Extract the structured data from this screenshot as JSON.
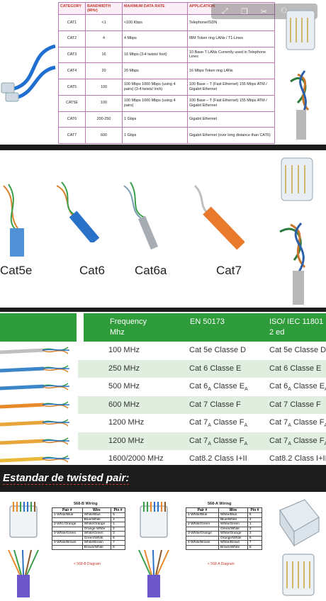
{
  "panel1": {
    "headers": [
      "CATEGORY",
      "BANDWIDTH (MHz)",
      "MAXIMUM DATA RATE",
      "APPLICATION"
    ],
    "rows": [
      {
        "category": "CAT1",
        "bandwidth": "<1",
        "rate": "<100 Kbps",
        "application": "Telephone/ISDN"
      },
      {
        "category": "CAT2",
        "bandwidth": "4",
        "rate": "4 Mbps",
        "application": "IBM Token ring LANs / T1-Lines"
      },
      {
        "category": "CAT3",
        "bandwidth": "16",
        "rate": "16 Mbps (3-4 twists/ foot)",
        "application": "10 Base-T LANs Currently used in Telephone Lines"
      },
      {
        "category": "CAT4",
        "bandwidth": "20",
        "rate": "20 Mbps",
        "application": "16 Mbps Token ring LANs"
      },
      {
        "category": "CAT5",
        "bandwidth": "100",
        "rate": "100 Mbps 1000 Mbps (using 4 pairs) (3-4 twists/ inch)",
        "application": "100 Base – T (Fast Ethernet) 155 Mbps ATM / Gigabit Ethernet"
      },
      {
        "category": "CAT5E",
        "bandwidth": "100",
        "rate": "100 Mbps 1000 Mbps (using 4 pairs)",
        "application": "100 Base – T (Fast Ethernet) 155 Mbps ATM / Gigabit Ethernet"
      },
      {
        "category": "CAT6",
        "bandwidth": "200-250",
        "rate": "1 Gbps",
        "application": "Gigabit Ethernet"
      },
      {
        "category": "CAT7",
        "bandwidth": "600",
        "rate": "1 Gbps",
        "application": "Gigabit Ethernet (over long distance than CAT6)"
      }
    ]
  },
  "panel2": {
    "labels": [
      "Cat5e",
      "Cat6",
      "Cat6a",
      "Cat7"
    ]
  },
  "panel3": {
    "headers": {
      "frequency": "Frequency Mhz",
      "en": "EN 50173",
      "iso": "ISO/ IEC 11801 2 ed"
    },
    "rows": [
      {
        "freq": "100 MHz",
        "en": "Cat 5e Classe D",
        "iso": "Cat 5e Classe D",
        "color": "#bfbfbf"
      },
      {
        "freq": "250 MHz",
        "en": "Cat 6 Classe E",
        "iso": "Cat 6 Classe E",
        "color": "#3a86c8"
      },
      {
        "freq": "500 MHz",
        "en_a": "Cat 6",
        "en_sub": "A",
        "en_b": " Classe E",
        "en_sub2": "A",
        "color": "#3a86c8"
      },
      {
        "freq": "600 MHz",
        "en": "Cat 7 Classe F",
        "iso": "Cat 7 Classe F",
        "color": "#e8892b"
      },
      {
        "freq": "1200 MHz",
        "en_a": "Cat 7",
        "en_sub": "A",
        "en_b": " Classe F",
        "en_sub2": "A",
        "color": "#e8a53a"
      },
      {
        "freq": "1200 MHz",
        "en_a": "Cat 7",
        "en_sub": "A",
        "en_b": " Classe F",
        "en_sub2": "A",
        "color": "#e8a53a"
      },
      {
        "freq": "1600/2000 MHz",
        "en": "Cat8.2 Class I+II",
        "iso": "Cat8.2 Class I+II",
        "color": "#e8b93a"
      }
    ]
  },
  "panel4": {
    "title": "Estandar de twisted pair:",
    "b_title": "568-B Wiring",
    "a_title": "568-A Wiring",
    "table_headers": [
      "Pair #",
      "Wire",
      "Pin #"
    ],
    "b_rows": [
      [
        "1-White/Blue",
        "White/Blue",
        "5"
      ],
      [
        "",
        "Blue/White",
        "4"
      ],
      [
        "2-Wht./Orange",
        "White/Orange",
        "1"
      ],
      [
        "",
        "Orange White",
        "2"
      ],
      [
        "3-White/Green",
        "White/Green",
        "3"
      ],
      [
        "",
        "Green/White",
        "6"
      ],
      [
        "4-White/Brown",
        "White/Brown",
        "7"
      ],
      [
        "",
        "Brown/White",
        "8"
      ]
    ],
    "a_rows": [
      [
        "1-White/Blue",
        "White/Blue",
        "5"
      ],
      [
        "",
        "Blue/White",
        "4"
      ],
      [
        "2-White/Green",
        "White/Green",
        "1"
      ],
      [
        "",
        "Green/White",
        "2"
      ],
      [
        "3-White/Orange",
        "White/Orange",
        "3"
      ],
      [
        "",
        "Orange/White",
        "6"
      ],
      [
        "4-White/Brown",
        "White/Brown",
        "7"
      ],
      [
        "",
        "Brown/White",
        "8"
      ]
    ],
    "b_caption": "< 568-B Diagram",
    "a_caption": "< 568-A Diagram"
  }
}
